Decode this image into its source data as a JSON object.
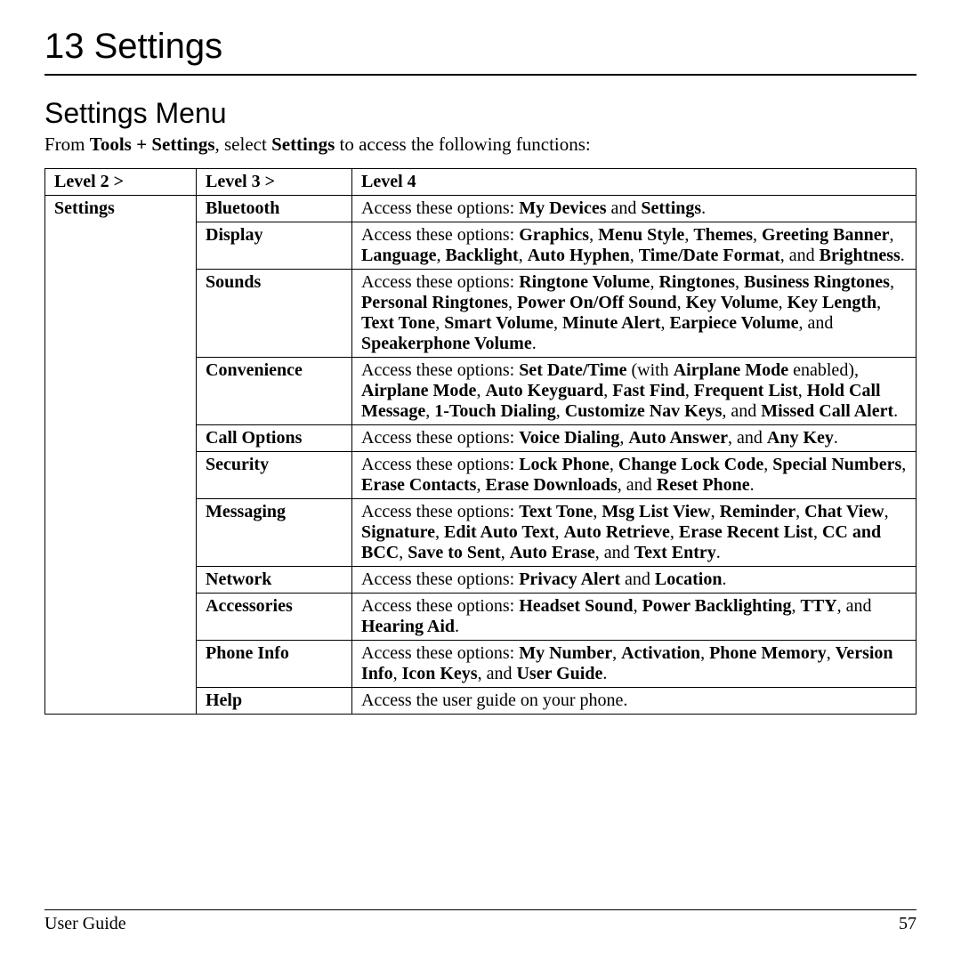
{
  "chapter": "13  Settings",
  "section": "Settings Menu",
  "intro": {
    "pre": "From ",
    "b1": "Tools + Settings",
    "mid": ", select ",
    "b2": "Settings",
    "post": " to access the following functions:"
  },
  "headers": {
    "h1": "Level 2 >",
    "h2": "Level 3 >",
    "h3": "Level 4"
  },
  "level2": "Settings",
  "rows": [
    {
      "l3": "Bluetooth",
      "plain1": "Access these options: ",
      "bold1": "My Devices",
      "plain2": " and ",
      "bold2": "Settings",
      "plain3": "."
    },
    {
      "l3": "Display",
      "plain1": "Access these options: ",
      "bold1": "Graphics",
      "sep1": ", ",
      "bold2": "Menu Style",
      "sep2": ", ",
      "bold3": "Themes",
      "sep3": ", ",
      "bold4": "Greeting Banner",
      "sep4": ", ",
      "bold5": "Language",
      "sep5": ", ",
      "bold6": "Backlight",
      "sep6": ", ",
      "bold7": "Auto Hyphen",
      "sep7": ", ",
      "bold8": "Time/Date Format",
      "plain2": ", and ",
      "bold9": "Brightness",
      "plain3": "."
    },
    {
      "l3": "Sounds",
      "plain1": "Access these options: ",
      "bold1": "Ringtone Volume",
      "sep1": ", ",
      "bold2": "Ringtones",
      "sep2": ", ",
      "bold3": "Business Ringtones",
      "sep3": ", ",
      "bold4": "Personal Ringtones",
      "sep4": ", ",
      "bold5": "Power On/Off Sound",
      "sep5": ", ",
      "bold6": "Key Volume",
      "sep6": ", ",
      "bold7": "Key Length",
      "sep7": ", ",
      "bold8": "Text Tone",
      "sep8": ", ",
      "bold9": "Smart Volume",
      "sep9": ", ",
      "bold10": "Minute Alert",
      "sep10": ", ",
      "bold11": "Earpiece Volume",
      "plain2": ", and ",
      "bold12": "Speakerphone Volume",
      "plain3": "."
    },
    {
      "l3": "Convenience",
      "plain1": "Access these options: ",
      "bold1": "Set Date/Time",
      "mid1": " (with ",
      "bold2": "Airplane Mode",
      "mid2": " enabled), ",
      "bold3": "Airplane Mode",
      "sep3": ", ",
      "bold4": "Auto Keyguard",
      "sep4": ", ",
      "bold5": "Fast Find",
      "sep5": ", ",
      "bold6": "Frequent List",
      "sep6": ", ",
      "bold7": "Hold Call Message",
      "sep7": ", ",
      "bold8": "1-Touch Dialing",
      "sep8": ", ",
      "bold9": "Customize Nav Keys",
      "plain2": ", and ",
      "bold10": "Missed Call Alert",
      "plain3": "."
    },
    {
      "l3": "Call Options",
      "plain1": "Access these options: ",
      "bold1": "Voice Dialing",
      "sep1": ", ",
      "bold2": "Auto Answer",
      "plain2": ", and ",
      "bold3": "Any Key",
      "plain3": "."
    },
    {
      "l3": "Security",
      "plain1": "Access these options: ",
      "bold1": "Lock Phone",
      "sep1": ", ",
      "bold2": "Change Lock Code",
      "sep2": ", ",
      "bold3": "Special Numbers",
      "sep3": ", ",
      "bold4": "Erase Contacts",
      "sep4": ", ",
      "bold5": "Erase Downloads",
      "plain2": ", and ",
      "bold6": "Reset Phone",
      "plain3": "."
    },
    {
      "l3": "Messaging",
      "plain1": "Access these options: ",
      "bold1": "Text Tone",
      "sep1": ", ",
      "bold2": "Msg List View",
      "sep2": ", ",
      "bold3": "Reminder",
      "sep3": ", ",
      "bold4": "Chat View",
      "sep4": ", ",
      "bold5": "Signature",
      "sep5": ", ",
      "bold6": "Edit Auto Text",
      "sep6": ", ",
      "bold7": "Auto Retrieve",
      "sep7": ", ",
      "bold8": "Erase Recent List",
      "sep8": ", ",
      "bold9": "CC and BCC",
      "sep9": ", ",
      "bold10": "Save to Sent",
      "sep10": ", ",
      "bold11": "Auto Erase",
      "plain2": ", and ",
      "bold12": "Text Entry",
      "plain3": "."
    },
    {
      "l3": "Network",
      "plain1": "Access these options: ",
      "bold1": "Privacy Alert",
      "plain2": " and ",
      "bold2": "Location",
      "plain3": "."
    },
    {
      "l3": "Accessories",
      "plain1": "Access these options: ",
      "bold1": "Headset Sound",
      "sep1": ", ",
      "bold2": "Power Backlighting",
      "sep2": ", ",
      "bold3": "TTY",
      "plain2": ", and ",
      "bold4": "Hearing Aid",
      "plain3": "."
    },
    {
      "l3": "Phone Info",
      "plain1": "Access these options: ",
      "bold1": "My Number",
      "sep1": ", ",
      "bold2": "Activation",
      "sep2": ", ",
      "bold3": "Phone Memory",
      "sep3": ", ",
      "bold4": "Version Info",
      "sep4": ", ",
      "bold5": "Icon Keys",
      "plain2": ", and ",
      "bold6": "User Guide",
      "plain3": "."
    },
    {
      "l3": "Help",
      "plain1": "Access the user guide on your phone."
    }
  ],
  "footer": {
    "left": "User Guide",
    "right": "57"
  }
}
